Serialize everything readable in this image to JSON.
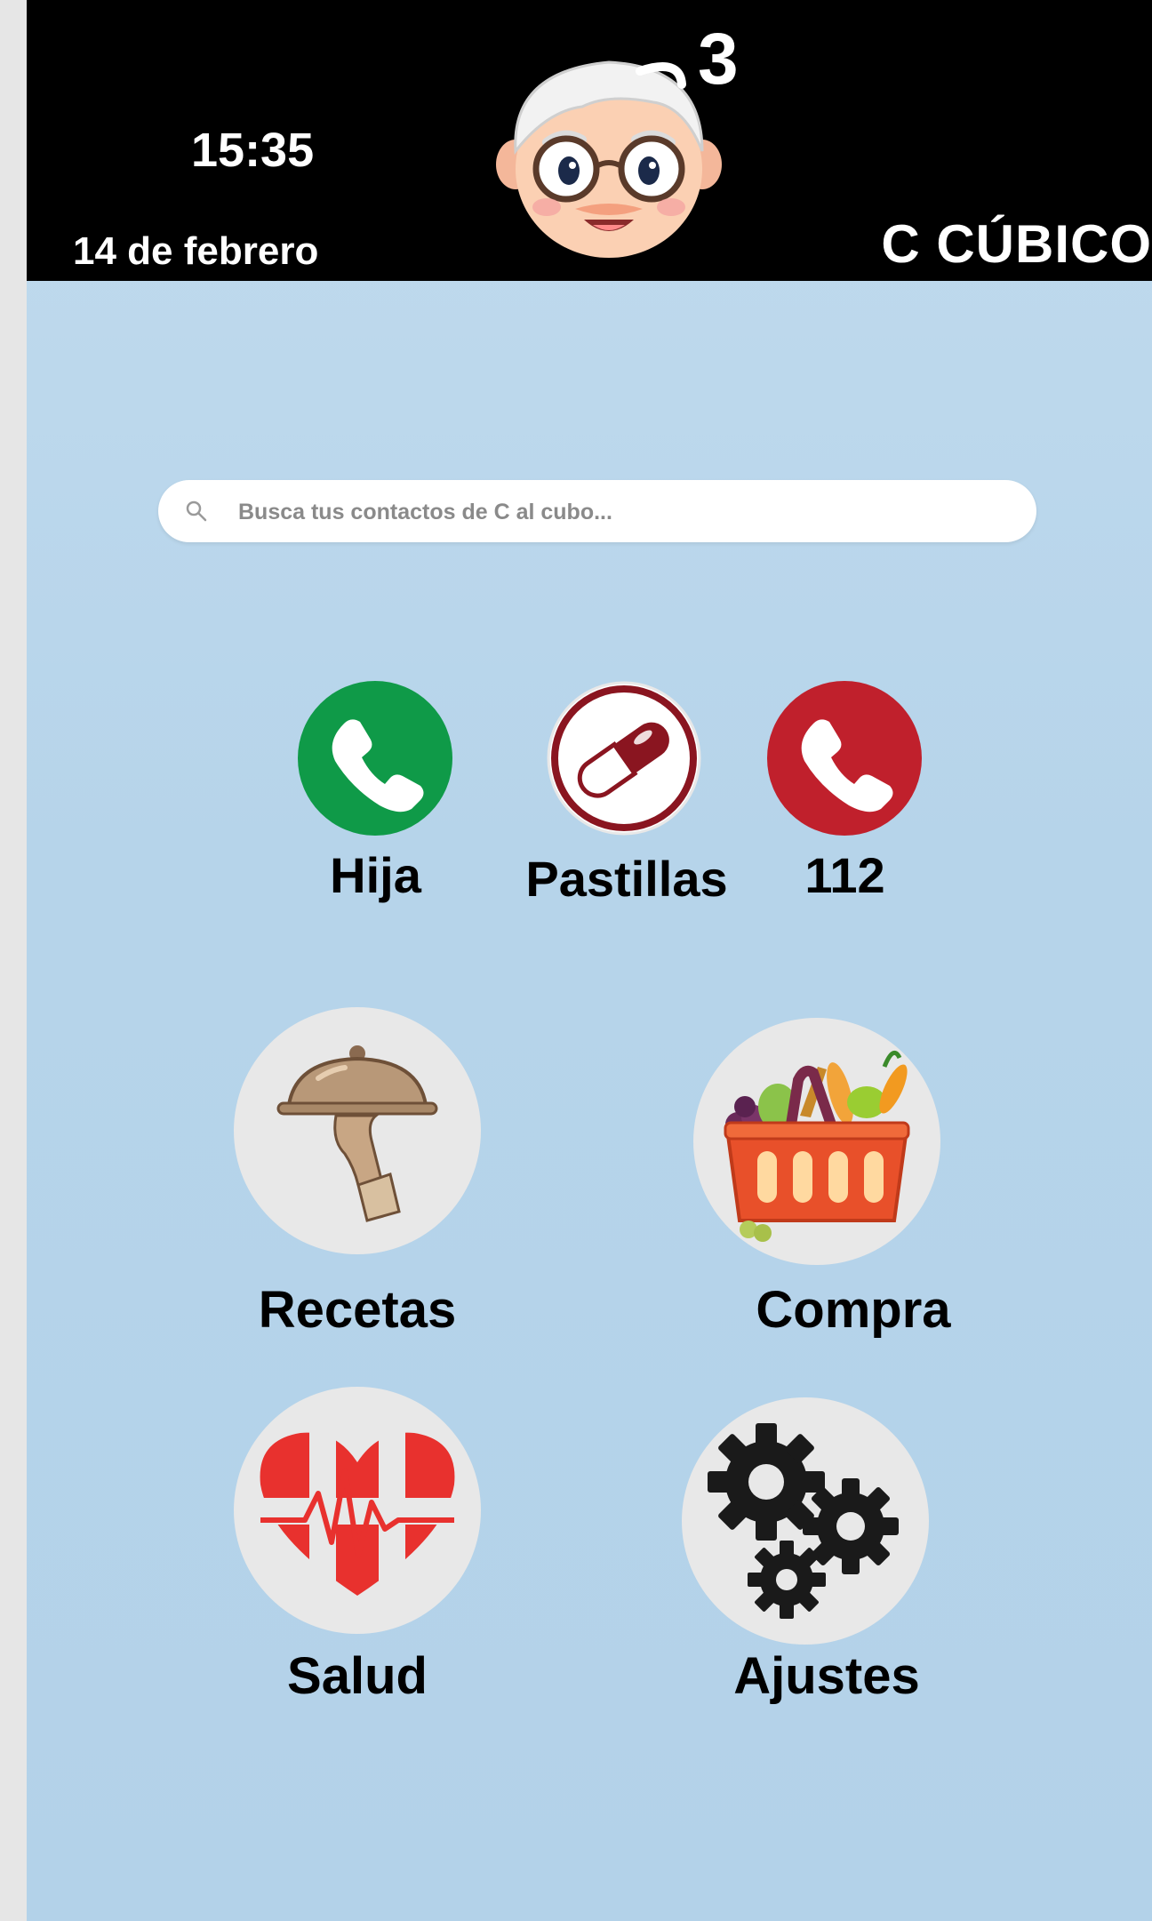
{
  "header": {
    "time": "15:35",
    "date": "14 de febrero",
    "brand": "C CÚBICO",
    "notification_count": "3"
  },
  "search": {
    "placeholder": "Busca tus contactos de C al cubo..."
  },
  "quick_actions": [
    {
      "label": "Hija",
      "icon": "phone-green-icon",
      "color": "#0f9a48"
    },
    {
      "label": "Pastillas",
      "icon": "pill-icon",
      "color": "#8a1520"
    },
    {
      "label": "112",
      "icon": "phone-red-icon",
      "color": "#c0202c"
    }
  ],
  "apps": [
    {
      "label": "Recetas",
      "icon": "serving-cloche-icon"
    },
    {
      "label": "Compra",
      "icon": "shopping-basket-icon"
    },
    {
      "label": "Salud",
      "icon": "heart-health-icon"
    },
    {
      "label": "Ajustes",
      "icon": "gears-icon"
    }
  ]
}
